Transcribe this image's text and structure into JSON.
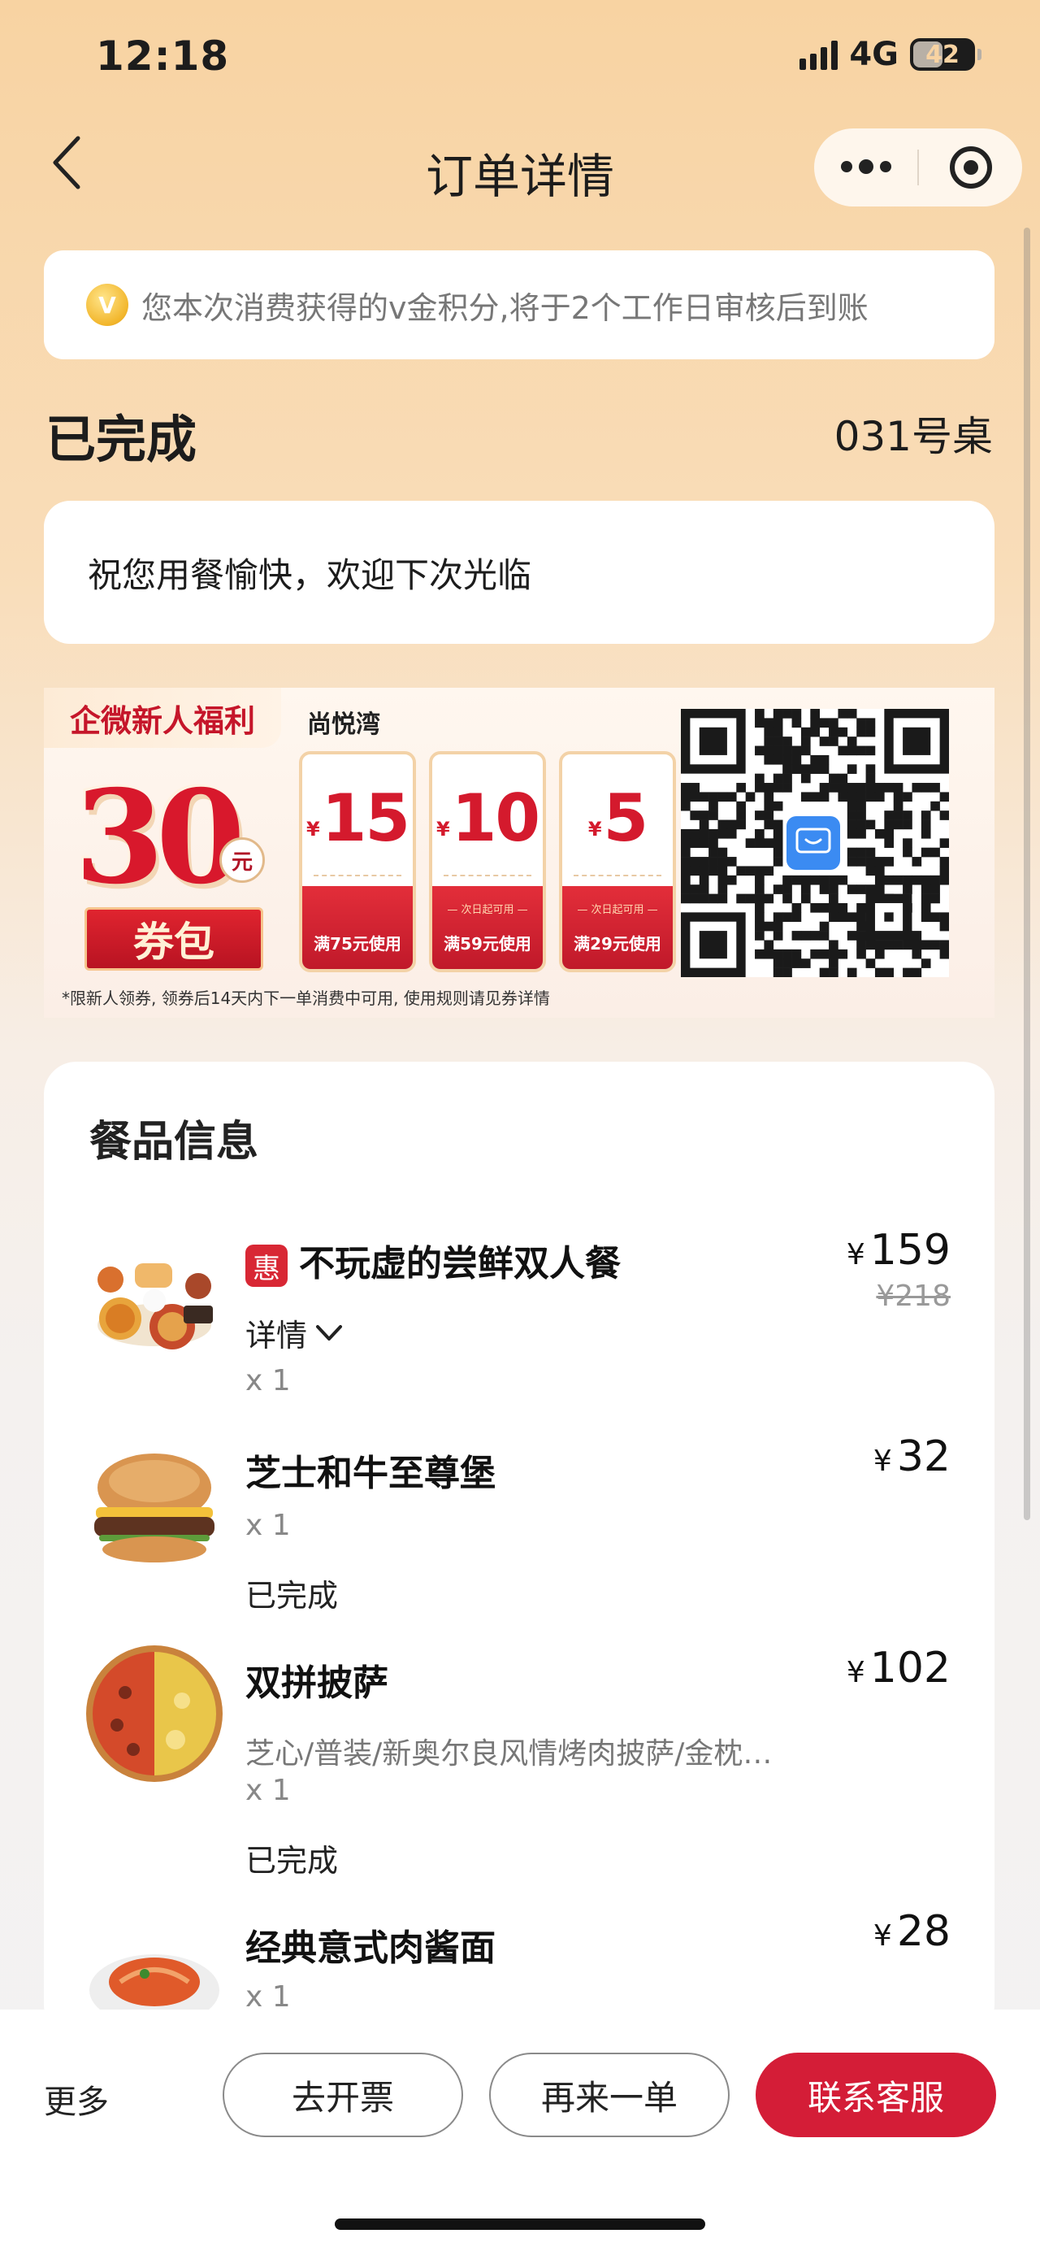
{
  "status_bar": {
    "time": "12:18",
    "network": "4G",
    "battery": "42"
  },
  "nav": {
    "title": "订单详情",
    "back_icon": "chevron-left-icon",
    "more_icon": "more-dots-icon",
    "close_icon": "target-icon"
  },
  "notice": {
    "coin_label": "V",
    "text": "您本次消费获得的v金积分,将于2个工作日审核后到账"
  },
  "order": {
    "status": "已完成",
    "table": "031号桌",
    "greeting": "祝您用餐愉快，欢迎下次光临"
  },
  "promo": {
    "tag": "企微新人福利",
    "store": "尚悦湾",
    "amount": "30",
    "amount_unit": "元",
    "bundle": "券包",
    "coupons": [
      {
        "symbol": "¥",
        "value": "15",
        "sub": "",
        "condition": "满75元使用"
      },
      {
        "symbol": "¥",
        "value": "10",
        "sub": "— 次日起可用 —",
        "condition": "满59元使用"
      },
      {
        "symbol": "¥",
        "value": "5",
        "sub": "— 次日起可用 —",
        "condition": "满29元使用"
      }
    ],
    "disclaimer": "*限新人领券, 领券后14天内下一单消费中可用, 使用规则请见券详情",
    "qr_center_icon": "wecom-chat-icon"
  },
  "food": {
    "title": "餐品信息",
    "items": [
      {
        "tag": "惠",
        "name": "不玩虚的尝鲜双人餐",
        "detail": "详情",
        "qty": "x 1",
        "price": "159",
        "original_price": "¥218"
      },
      {
        "name": "芝士和牛至尊堡",
        "qty": "x 1",
        "status": "已完成",
        "price": "32"
      },
      {
        "name": "双拼披萨",
        "spec": "芝心/普装/新奥尔良风情烤肉披萨/金枕…",
        "qty": "x 1",
        "status": "已完成",
        "price": "102"
      },
      {
        "name": "经典意式肉酱面",
        "qty": "x 1",
        "price": "28"
      }
    ],
    "currency": "¥"
  },
  "bottom_bar": {
    "more": "更多",
    "invoice": "去开票",
    "reorder": "再来一单",
    "contact": "联系客服"
  },
  "colors": {
    "accent": "#d41d37",
    "background_top": "#f8d3a2",
    "coupon_red": "#d8182c"
  }
}
